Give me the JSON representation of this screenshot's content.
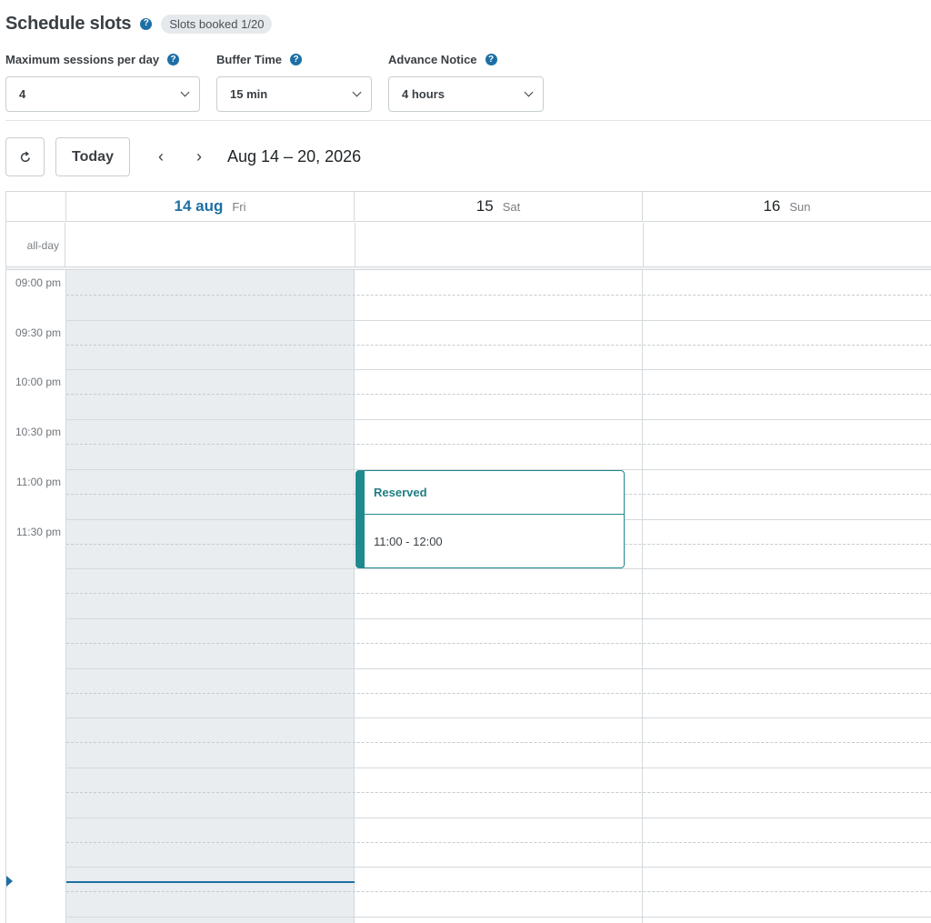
{
  "header": {
    "title": "Schedule slots",
    "help_icon": "question-circle-icon",
    "badge": "Slots booked 1/20"
  },
  "settings": {
    "max_sessions": {
      "label": "Maximum sessions per day",
      "value": "4"
    },
    "buffer_time": {
      "label": "Buffer Time",
      "value": "15 min"
    },
    "advance_notice": {
      "label": "Advance Notice",
      "value": "4 hours"
    }
  },
  "toolbar": {
    "refresh_icon": "refresh-icon",
    "today_label": "Today",
    "prev_label": "‹",
    "next_label": "›",
    "range": "Aug 14 – 20, 2026"
  },
  "calendar": {
    "days": [
      {
        "num": "14 aug",
        "day": "Fri",
        "today": true
      },
      {
        "num": "15",
        "day": "Sat",
        "today": false
      },
      {
        "num": "16",
        "day": "Sun",
        "today": false
      }
    ],
    "allday_label": "all-day",
    "times": [
      "09:00 pm",
      "09:30 pm",
      "10:00 pm",
      "10:30 pm",
      "11:00 pm",
      "11:30 pm"
    ],
    "event": {
      "title": "Reserved",
      "time": "11:00 - 12:00",
      "color": "#1f8a8e"
    },
    "accent": "#1d6fa5"
  }
}
